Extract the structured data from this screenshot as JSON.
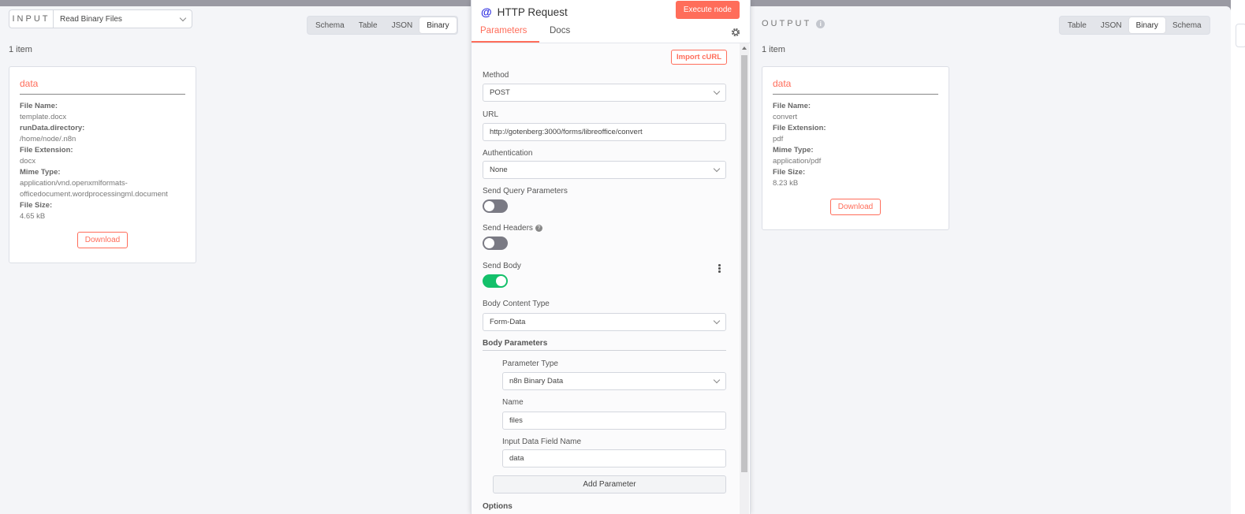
{
  "input_panel": {
    "label": "INPUT",
    "selected_node": "Read Binary Files",
    "view_tabs": [
      "Schema",
      "Table",
      "JSON",
      "Binary"
    ],
    "active_tab": "Binary",
    "item_count": "1 item",
    "card": {
      "title": "data",
      "fields": [
        {
          "key": "File Name:",
          "value": "template.docx"
        },
        {
          "key": "runData.directory:",
          "value": "/home/node/.n8n"
        },
        {
          "key": "File Extension:",
          "value": "docx"
        },
        {
          "key": "Mime Type:",
          "value": "application/vnd.openxmlformats-officedocument.wordprocessingml.document"
        },
        {
          "key": "File Size:",
          "value": "4.65 kB"
        }
      ],
      "mime_line1": "application/vnd.openxmlformats-",
      "mime_line2": "officedocument.wordprocessingml.document",
      "download_label": "Download"
    }
  },
  "settings": {
    "node_icon": "@",
    "title": "HTTP Request",
    "execute_label": "Execute node",
    "tabs": [
      "Parameters",
      "Docs"
    ],
    "active_tab": "Parameters",
    "import_curl": "Import cURL",
    "method_label": "Method",
    "method_value": "POST",
    "url_label": "URL",
    "url_value": "http://gotenberg:3000/forms/libreoffice/convert",
    "auth_label": "Authentication",
    "auth_value": "None",
    "send_query_label": "Send Query Parameters",
    "send_query_on": false,
    "send_headers_label": "Send Headers",
    "send_headers_on": false,
    "send_body_label": "Send Body",
    "send_body_on": true,
    "body_content_type_label": "Body Content Type",
    "body_content_type_value": "Form-Data",
    "body_params_title": "Body Parameters",
    "param_type_label": "Parameter Type",
    "param_type_value": "n8n Binary Data",
    "name_label": "Name",
    "name_value": "files",
    "input_field_label": "Input Data Field Name",
    "input_field_value": "data",
    "add_param_label": "Add Parameter",
    "options_title": "Options"
  },
  "output_panel": {
    "label": "OUTPUT",
    "view_tabs": [
      "Table",
      "JSON",
      "Binary",
      "Schema"
    ],
    "active_tab": "Binary",
    "item_count": "1 item",
    "card": {
      "title": "data",
      "fields": [
        {
          "key": "File Name:",
          "value": "convert"
        },
        {
          "key": "File Extension:",
          "value": "pdf"
        },
        {
          "key": "Mime Type:",
          "value": "application/pdf"
        },
        {
          "key": "File Size:",
          "value": "8.23 kB"
        }
      ],
      "download_label": "Download"
    }
  },
  "colors": {
    "accent": "#ff6d5a",
    "toggle_on": "#13c06a",
    "toggle_off": "#7a7a84",
    "node_icon": "#2a2ae0"
  }
}
